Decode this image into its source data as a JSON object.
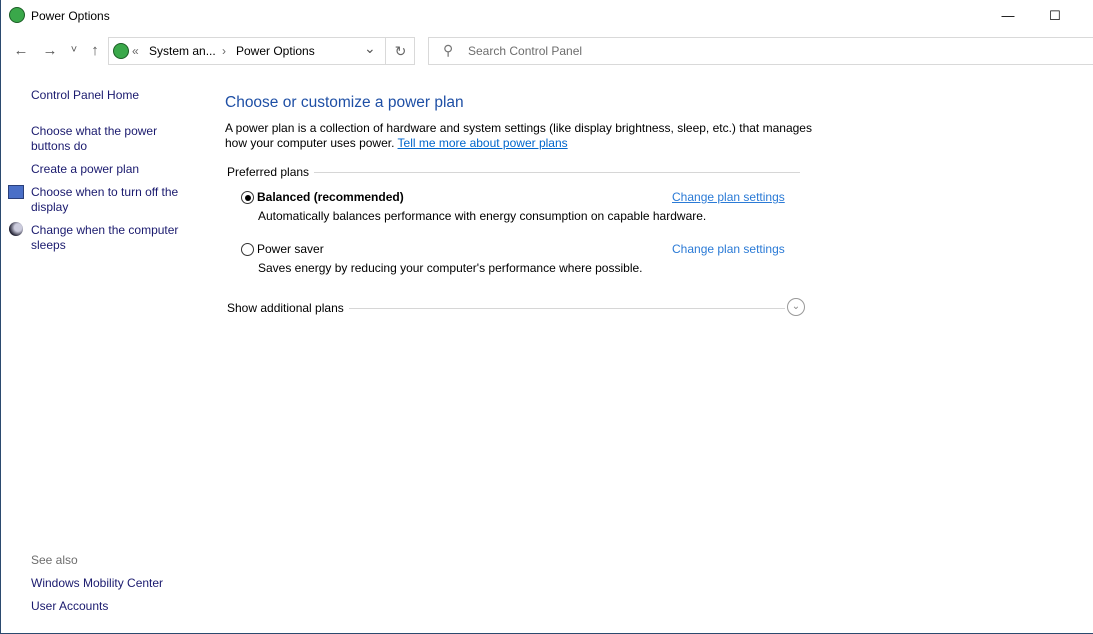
{
  "window": {
    "title": "Power Options",
    "minimize": "—",
    "maximize": "☐"
  },
  "address": {
    "overflow": "«",
    "crumbs": [
      "System an...",
      "Power Options"
    ],
    "sep": "›",
    "dropdown": "⌄",
    "refresh": "↻"
  },
  "search": {
    "placeholder": "Search Control Panel",
    "icon": "⚲"
  },
  "nav": {
    "back": "←",
    "forward": "→",
    "recent": "˅",
    "up": "↑"
  },
  "sidebar": {
    "home": "Control Panel Home",
    "items": [
      "Choose what the power buttons do",
      "Create a power plan",
      "Choose when to turn off the display",
      "Change when the computer sleeps"
    ],
    "see_also": "See also",
    "see_also_items": [
      "Windows Mobility Center",
      "User Accounts"
    ]
  },
  "main": {
    "title": "Choose or customize a power plan",
    "description": "A power plan is a collection of hardware and system settings (like display brightness, sleep, etc.) that manages how your computer uses power.",
    "learn_more": "Tell me more about power plans",
    "preferred": "Preferred plans",
    "plans": [
      {
        "name": "Balanced (recommended)",
        "selected": true,
        "description": "Automatically balances performance with energy consumption on capable hardware.",
        "link": "Change plan settings"
      },
      {
        "name": "Power saver",
        "selected": false,
        "description": "Saves energy by reducing your computer's performance where possible.",
        "link": "Change plan settings"
      }
    ],
    "additional": "Show additional plans",
    "expand": "⌄"
  }
}
